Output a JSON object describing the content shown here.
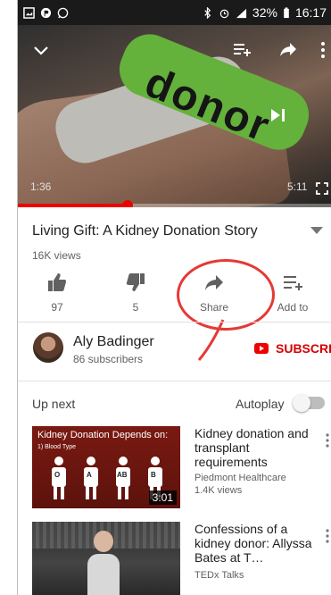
{
  "status_bar": {
    "battery": "32%",
    "time": "16:17"
  },
  "video": {
    "time_current": "1:36",
    "time_total": "5:11",
    "progress_fraction": 0.35,
    "overlay_text": "donor"
  },
  "info": {
    "title": "Living Gift: A Kidney Donation Story",
    "views": "16K views"
  },
  "actions": [
    {
      "icon": "thumbs-up-icon",
      "label": "97"
    },
    {
      "icon": "thumbs-down-icon",
      "label": "5"
    },
    {
      "icon": "share-icon",
      "label": "Share"
    },
    {
      "icon": "add-to-playlist-icon",
      "label": "Add to"
    }
  ],
  "channel": {
    "name": "Aly Badinger",
    "subscribers": "86 subscribers",
    "subscribe_label": "SUBSCRIBE"
  },
  "up_next": {
    "label": "Up next",
    "autoplay_label": "Autoplay",
    "autoplay_on": false
  },
  "related": [
    {
      "title": "Kidney donation and transplant requirements",
      "channel": "Piedmont Healthcare",
      "views": "1.4K views",
      "duration": "3:01",
      "thumb_title": "Kidney Donation Depends on:",
      "thumb_subtitle": "1) Blood Type",
      "thumb_labels": [
        "O",
        "A",
        "AB",
        "B"
      ]
    },
    {
      "title": "Confessions of a kidney donor: Allyssa Bates at T…",
      "channel": "TEDx Talks",
      "views": ""
    }
  ],
  "colors": {
    "accent_red": "#e00000",
    "annotation_red": "#e53935"
  }
}
